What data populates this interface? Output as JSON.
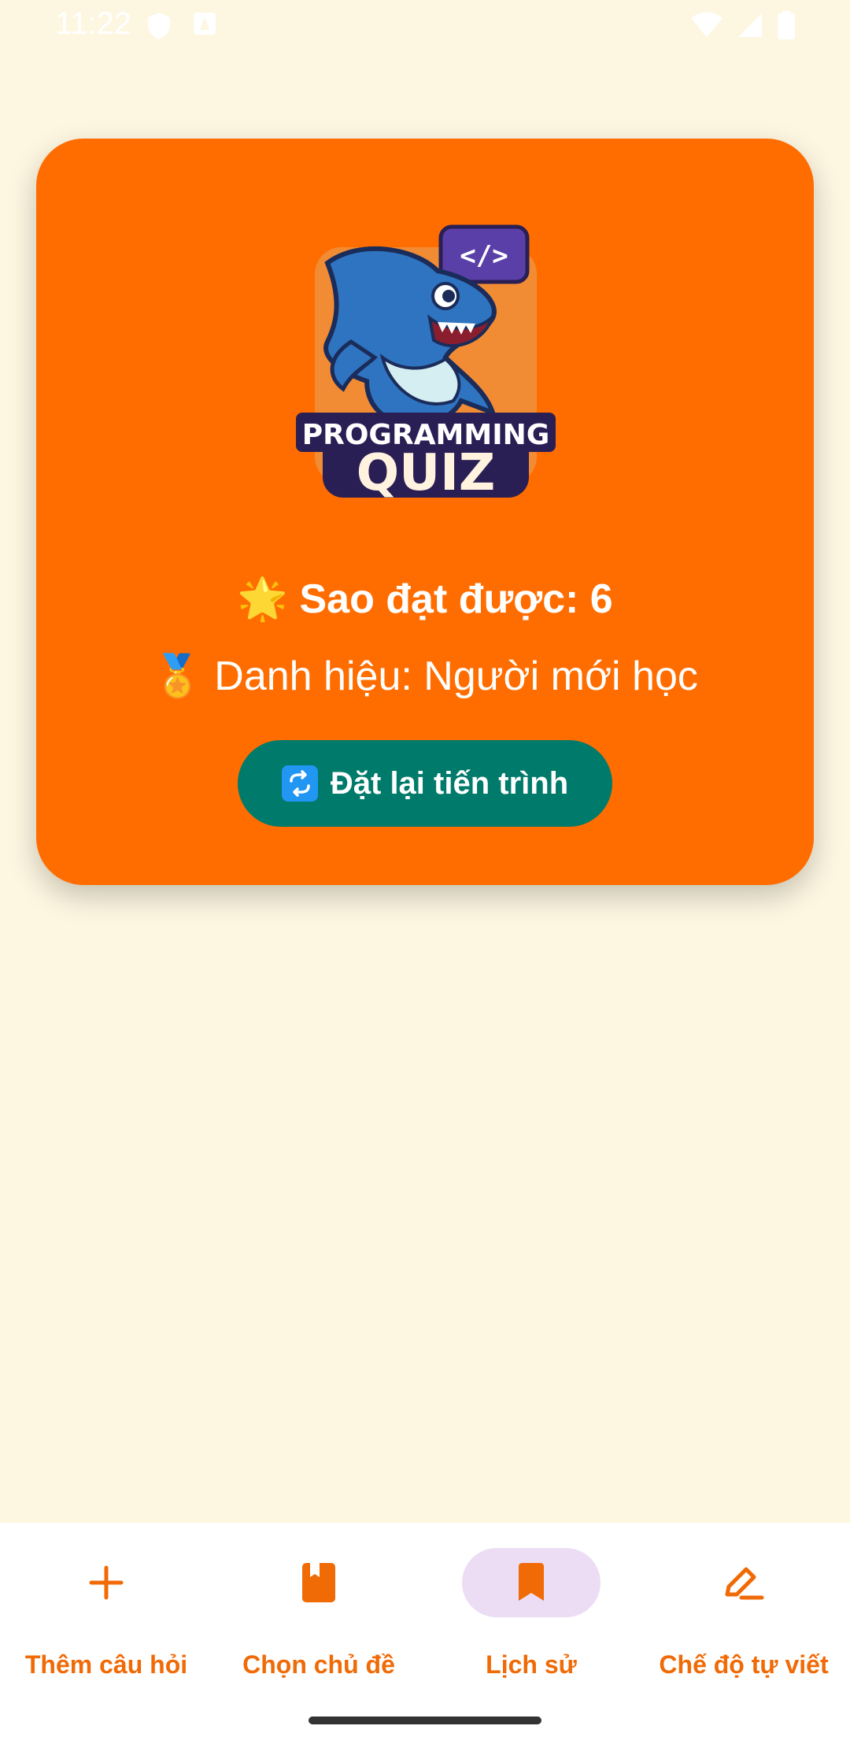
{
  "status_bar": {
    "time": "11:22"
  },
  "card": {
    "logo": {
      "line1": "PROGRAMMING",
      "line2": "QUIZ",
      "code_tag": "</>"
    },
    "stars_text": "🌟 Sao đạt được: 6",
    "title_text": "🏅 Danh hiệu: Người mới học",
    "reset_button_label": "Đặt lại tiến trình"
  },
  "bottom_nav": {
    "active_index": 2,
    "items": [
      {
        "label": "Thêm câu hỏi",
        "icon": "plus-icon"
      },
      {
        "label": "Chọn chủ đề",
        "icon": "book-icon"
      },
      {
        "label": "Lịch sử",
        "icon": "bookmark-icon"
      },
      {
        "label": "Chế độ tự viết",
        "icon": "pencil-icon"
      }
    ]
  },
  "colors": {
    "background": "#FDF6E1",
    "card": "#FF6D00",
    "button": "#007A6B",
    "nav_accent": "#F06A06",
    "nav_active_pill": "#ECDDF5"
  }
}
